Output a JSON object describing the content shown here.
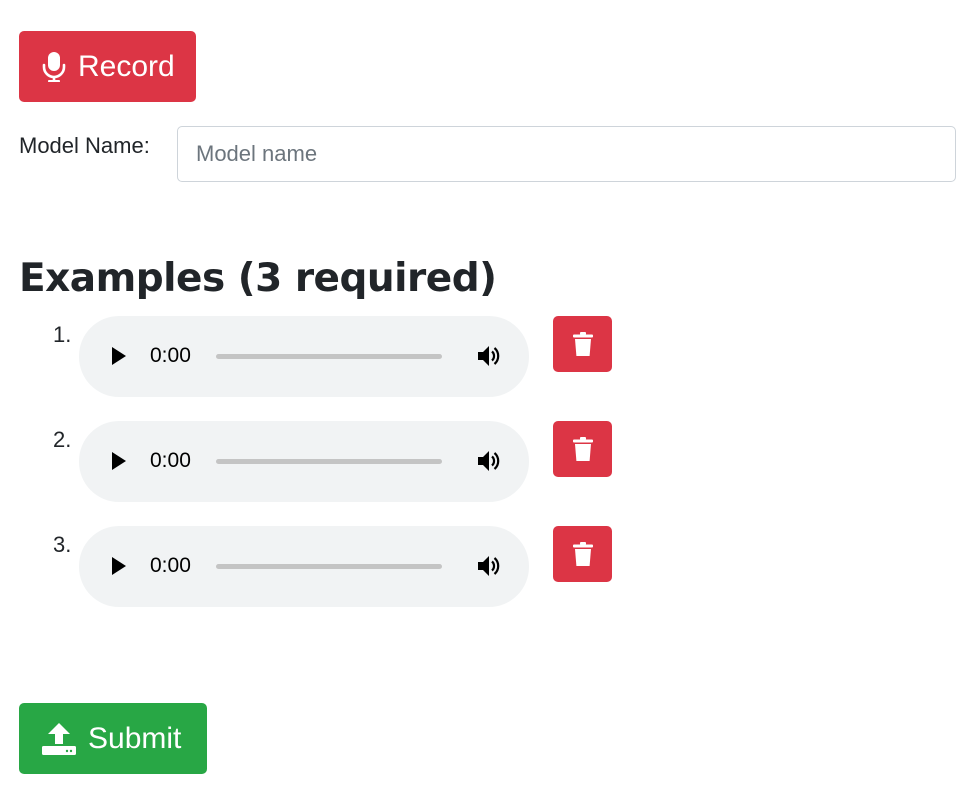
{
  "record_button": {
    "label": "Record",
    "icon": "microphone-icon",
    "color": "#dc3545"
  },
  "model_name": {
    "label": "Model Name:",
    "value": "",
    "placeholder": "Model name"
  },
  "examples": {
    "heading": "Examples (3 required)",
    "items": [
      {
        "number": "1.",
        "time": "0:00",
        "progress": 0
      },
      {
        "number": "2.",
        "time": "0:00",
        "progress": 0
      },
      {
        "number": "3.",
        "time": "0:00",
        "progress": 0
      }
    ]
  },
  "submit_button": {
    "label": "Submit",
    "icon": "upload-icon",
    "color": "#28a745"
  }
}
